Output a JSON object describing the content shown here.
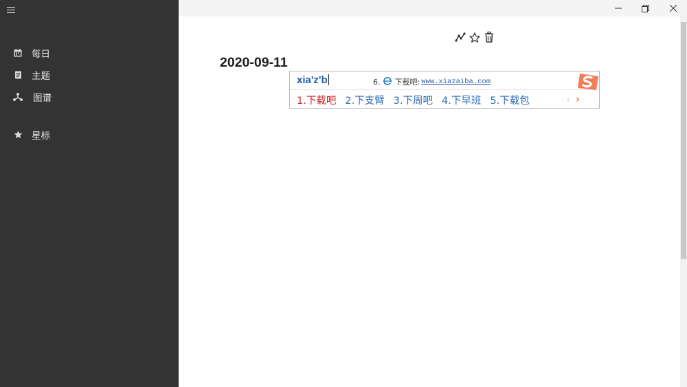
{
  "sidebar": {
    "menu_icon": "hamburger-icon",
    "items": [
      {
        "label": "每日",
        "icon": "calendar-icon"
      },
      {
        "label": "主题",
        "icon": "book-icon"
      },
      {
        "label": "图谱",
        "icon": "graph-icon"
      },
      {
        "label": "星标",
        "icon": "star-icon"
      }
    ]
  },
  "window": {
    "controls": [
      "minimize-icon",
      "restore-icon",
      "close-icon"
    ]
  },
  "toolbar": {
    "icons": [
      "link-icon",
      "star-outline-icon",
      "trash-icon"
    ]
  },
  "page": {
    "date": "2020-09-11"
  },
  "ime": {
    "pinyin": "xia'z'b",
    "web_candidate_index": "6.",
    "web_candidate_label": "下载吧:",
    "web_candidate_url": "www.xiazaiba.com",
    "candidates": [
      {
        "label": "1.下载吧",
        "active": true
      },
      {
        "label": "2.下支臂",
        "active": false
      },
      {
        "label": "3.下周吧",
        "active": false
      },
      {
        "label": "4.下早班",
        "active": false
      },
      {
        "label": "5.下载包",
        "active": false
      }
    ],
    "prev_arrow": "‹",
    "next_arrow": "›",
    "colors": {
      "active": "#c82020",
      "candidate": "#2e6cb3",
      "pinyin": "#1e5fae",
      "logo": "#f0663a"
    }
  }
}
